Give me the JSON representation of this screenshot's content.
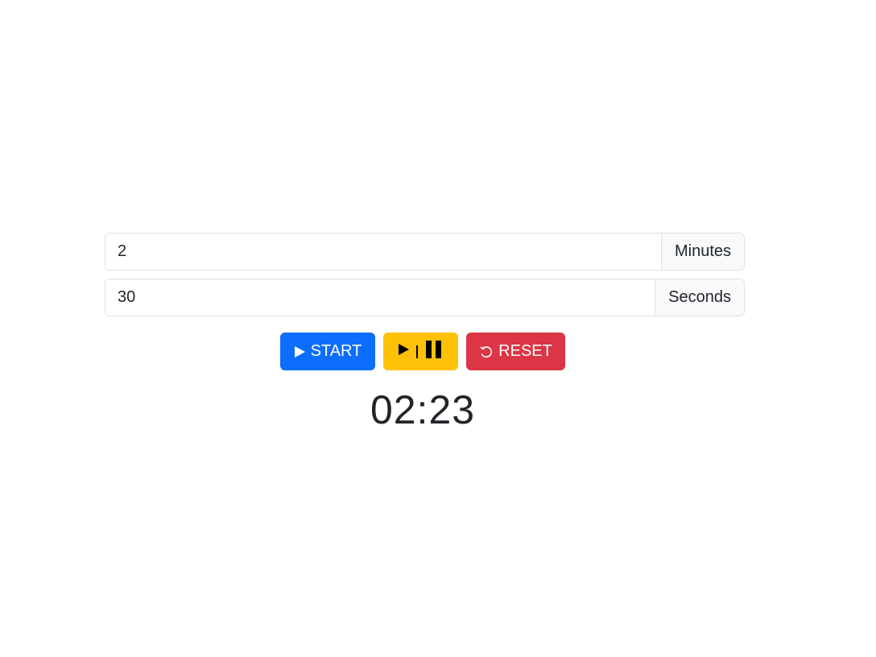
{
  "inputs": {
    "minutes_value": "2",
    "minutes_label": "Minutes",
    "seconds_value": "30",
    "seconds_label": "Seconds"
  },
  "buttons": {
    "start_label": "START",
    "reset_label": "RESET",
    "start_icon": "play-icon",
    "toggle_icons": [
      "play-icon",
      "pause-icon"
    ],
    "reset_icon": "reset-icon"
  },
  "timer": {
    "display": "02:23"
  },
  "colors": {
    "start": "#0d6efd",
    "toggle": "#ffc107",
    "reset": "#dc3545"
  }
}
